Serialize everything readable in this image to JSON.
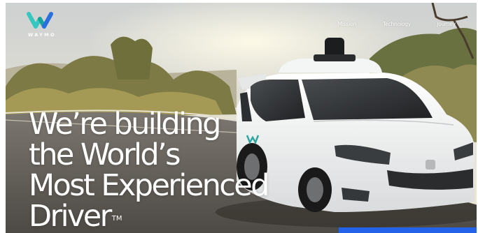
{
  "brand": {
    "logo_icon": "waymo-w-logo-icon",
    "wordmark": "WAYMO",
    "colors": {
      "logo_left": "#35c7c0",
      "logo_mid": "#1aa39e",
      "logo_right": "#2a6fe0"
    }
  },
  "nav": {
    "items": [
      {
        "label": "Mission"
      },
      {
        "label": "Technology"
      },
      {
        "label": "Journey"
      }
    ]
  },
  "hero": {
    "headline_lines": [
      "We’re building",
      "the World’s",
      "Most Experienced",
      "Driver"
    ],
    "trademark": "TM",
    "cta_color": "#2462ea"
  }
}
